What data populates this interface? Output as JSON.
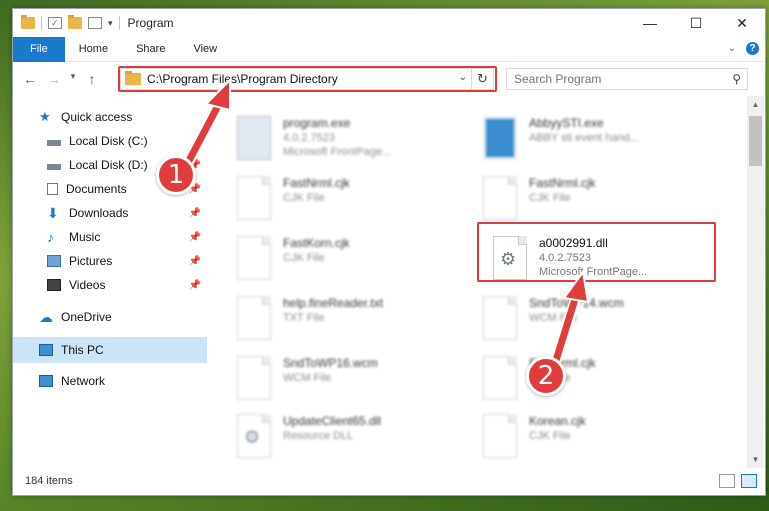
{
  "window": {
    "title": "Program"
  },
  "ribbon": {
    "tabs": [
      "File",
      "Home",
      "Share",
      "View"
    ]
  },
  "address": {
    "path": "C:\\Program Files\\Program Directory"
  },
  "search": {
    "placeholder": "Search Program"
  },
  "sidebar": {
    "items": [
      {
        "label": "Quick access",
        "icon": "star-icon",
        "pinned": false
      },
      {
        "label": "Local Disk (C:)",
        "icon": "drive-icon",
        "pinned": false
      },
      {
        "label": "Local Disk (D:)",
        "icon": "drive-icon",
        "pinned": true
      },
      {
        "label": "Documents",
        "icon": "documents-icon",
        "pinned": true
      },
      {
        "label": "Downloads",
        "icon": "download-icon",
        "pinned": true
      },
      {
        "label": "Music",
        "icon": "music-icon",
        "pinned": true
      },
      {
        "label": "Pictures",
        "icon": "pictures-icon",
        "pinned": true
      },
      {
        "label": "Videos",
        "icon": "videos-icon",
        "pinned": true
      },
      {
        "label": "OneDrive",
        "icon": "cloud-icon",
        "pinned": false
      },
      {
        "label": "This PC",
        "icon": "computer-icon",
        "pinned": false,
        "selected": true
      },
      {
        "label": "Network",
        "icon": "network-icon",
        "pinned": false
      }
    ]
  },
  "files": [
    {
      "name": "program.exe",
      "line2": "4.0.2.7523",
      "line3": "Microsoft FrontPage...",
      "icon": "exe"
    },
    {
      "name": "AbbyySTI.exe",
      "line2": "ABBY sti event hand...",
      "line3": "",
      "icon": "exe-blue"
    },
    {
      "name": "FastNrml.cjk",
      "line2": "CJK File",
      "line3": "",
      "icon": "doc"
    },
    {
      "name": "FastNrml.cjk",
      "line2": "CJK File",
      "line3": "",
      "icon": "doc"
    },
    {
      "name": "FastKorn.cjk",
      "line2": "CJK File",
      "line3": "",
      "icon": "doc"
    },
    {
      "name": "a0002991.dll",
      "line2": "4.0.2.7523",
      "line3": "Microsoft FrontPage...",
      "icon": "dll",
      "highlighted": true
    },
    {
      "name": "help.fineReader.txt",
      "line2": "TXT File",
      "line3": "",
      "icon": "doc"
    },
    {
      "name": "SndToWP14.wcm",
      "line2": "WCM File",
      "line3": "",
      "icon": "doc"
    },
    {
      "name": "SndToWP16.wcm",
      "line2": "WCM File",
      "line3": "",
      "icon": "doc"
    },
    {
      "name": "FastNrml.cjk",
      "line2": "CJK File",
      "line3": "",
      "icon": "doc"
    },
    {
      "name": "UpdateClient65.dll",
      "line2": "Resource DLL",
      "line3": "",
      "icon": "dll"
    },
    {
      "name": "Korean.cjk",
      "line2": "CJK File",
      "line3": "",
      "icon": "doc"
    }
  ],
  "status": {
    "count": "184 items"
  },
  "annotations": {
    "step1": "1",
    "step2": "2",
    "accent": "#e03c3c"
  }
}
